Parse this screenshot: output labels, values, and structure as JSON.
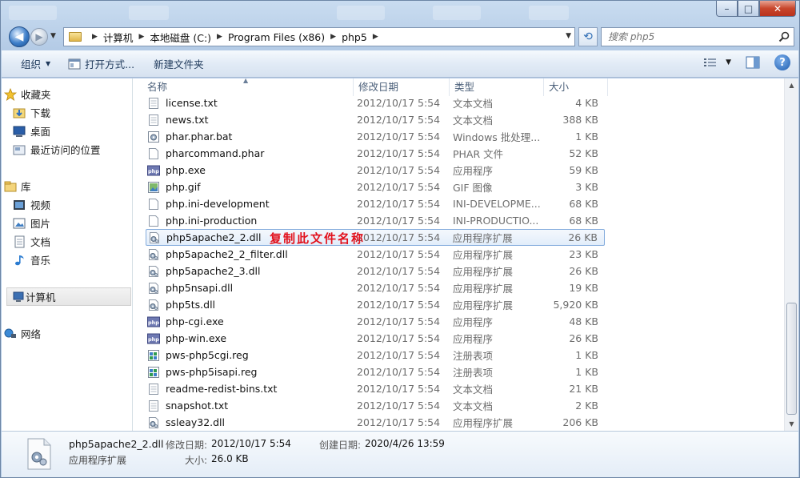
{
  "title_bar": {
    "ghost_tabs": [
      "",
      "",
      "",
      "",
      ""
    ]
  },
  "window_buttons": {
    "minimize": "–",
    "maximize": "□",
    "close": "✕"
  },
  "navigation": {
    "back_glyph": "◀",
    "forward_glyph": "▶",
    "breadcrumbs": [
      "计算机",
      "本地磁盘 (C:)",
      "Program Files (x86)",
      "php5"
    ],
    "search_placeholder": "搜索 php5"
  },
  "toolbar": {
    "organize": "组织",
    "open_with": "打开方式...",
    "new_folder": "新建文件夹"
  },
  "nav_pane": {
    "favorites": {
      "label": "收藏夹",
      "items": [
        "下载",
        "桌面",
        "最近访问的位置"
      ]
    },
    "libraries": {
      "label": "库",
      "items": [
        "视频",
        "图片",
        "文档",
        "音乐"
      ]
    },
    "computer": {
      "label": "计算机"
    },
    "network": {
      "label": "网络"
    }
  },
  "columns": {
    "name": "名称",
    "date": "修改日期",
    "type": "类型",
    "size": "大小"
  },
  "files": [
    {
      "name": "license.txt",
      "date": "2012/10/17 5:54",
      "type": "文本文档",
      "size": "4 KB",
      "icon": "txt"
    },
    {
      "name": "news.txt",
      "date": "2012/10/17 5:54",
      "type": "文本文档",
      "size": "388 KB",
      "icon": "txt"
    },
    {
      "name": "phar.phar.bat",
      "date": "2012/10/17 5:54",
      "type": "Windows 批处理...",
      "size": "1 KB",
      "icon": "bat"
    },
    {
      "name": "pharcommand.phar",
      "date": "2012/10/17 5:54",
      "type": "PHAR 文件",
      "size": "52 KB",
      "icon": "blank"
    },
    {
      "name": "php.exe",
      "date": "2012/10/17 5:54",
      "type": "应用程序",
      "size": "59 KB",
      "icon": "php"
    },
    {
      "name": "php.gif",
      "date": "2012/10/17 5:54",
      "type": "GIF 图像",
      "size": "3 KB",
      "icon": "gif"
    },
    {
      "name": "php.ini-development",
      "date": "2012/10/17 5:54",
      "type": "INI-DEVELOPME...",
      "size": "68 KB",
      "icon": "blank"
    },
    {
      "name": "php.ini-production",
      "date": "2012/10/17 5:54",
      "type": "INI-PRODUCTIO...",
      "size": "68 KB",
      "icon": "blank"
    },
    {
      "name": "php5apache2_2.dll",
      "date": "2012/10/17 5:54",
      "type": "应用程序扩展",
      "size": "26 KB",
      "icon": "dll",
      "selected": true
    },
    {
      "name": "php5apache2_2_filter.dll",
      "date": "2012/10/17 5:54",
      "type": "应用程序扩展",
      "size": "23 KB",
      "icon": "dll"
    },
    {
      "name": "php5apache2_3.dll",
      "date": "2012/10/17 5:54",
      "type": "应用程序扩展",
      "size": "26 KB",
      "icon": "dll"
    },
    {
      "name": "php5nsapi.dll",
      "date": "2012/10/17 5:54",
      "type": "应用程序扩展",
      "size": "19 KB",
      "icon": "dll"
    },
    {
      "name": "php5ts.dll",
      "date": "2012/10/17 5:54",
      "type": "应用程序扩展",
      "size": "5,920 KB",
      "icon": "dll"
    },
    {
      "name": "php-cgi.exe",
      "date": "2012/10/17 5:54",
      "type": "应用程序",
      "size": "48 KB",
      "icon": "php"
    },
    {
      "name": "php-win.exe",
      "date": "2012/10/17 5:54",
      "type": "应用程序",
      "size": "26 KB",
      "icon": "php"
    },
    {
      "name": "pws-php5cgi.reg",
      "date": "2012/10/17 5:54",
      "type": "注册表项",
      "size": "1 KB",
      "icon": "reg"
    },
    {
      "name": "pws-php5isapi.reg",
      "date": "2012/10/17 5:54",
      "type": "注册表项",
      "size": "1 KB",
      "icon": "reg"
    },
    {
      "name": "readme-redist-bins.txt",
      "date": "2012/10/17 5:54",
      "type": "文本文档",
      "size": "21 KB",
      "icon": "txt"
    },
    {
      "name": "snapshot.txt",
      "date": "2012/10/17 5:54",
      "type": "文本文档",
      "size": "2 KB",
      "icon": "txt"
    },
    {
      "name": "ssleay32.dll",
      "date": "2012/10/17 5:54",
      "type": "应用程序扩展",
      "size": "206 KB",
      "icon": "dll"
    }
  ],
  "annotation": "复制此文件名称",
  "details": {
    "name": "php5apache2_2.dll",
    "type": "应用程序扩展",
    "modified_label": "修改日期:",
    "modified": "2012/10/17 5:54",
    "created_label": "创建日期:",
    "created": "2020/4/26 13:59",
    "size_label": "大小:",
    "size": "26.0 KB"
  },
  "colors": {
    "selection_border": "#84acdd",
    "annotation": "#e2111c",
    "close_button": "#c8462c"
  }
}
